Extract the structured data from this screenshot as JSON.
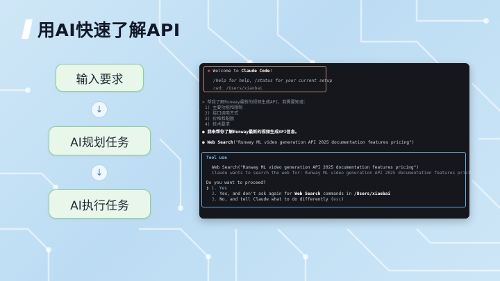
{
  "page": {
    "title": "用AI快速了解API"
  },
  "steps": [
    {
      "label": "输入要求"
    },
    {
      "label": "AI规划任务"
    },
    {
      "label": "AI执行任务"
    }
  ],
  "arrow_glyph": "↓",
  "terminal": {
    "welcome": {
      "bullet": "✻",
      "prefix": "Welcome to ",
      "app_name": "Claude Code",
      "suffix": "!",
      "help": "/help for help, /status for your current setup",
      "cwd": "cwd: /Users/xiaobai"
    },
    "prompt": {
      "marker": ">",
      "text": "帮我了解Runway最新的视频生成API，我需要知道：",
      "items": [
        "1) 主要功能和限制",
        "2) 接口调用方式",
        "3) 价格和配额",
        "4) 技术要求"
      ]
    },
    "reply": {
      "bullet": "●",
      "text": "我来帮你了解Runway最新的视频生成API信息。"
    },
    "tool_call": {
      "bullet": "●",
      "name": "Web Search",
      "args": "(\"Runway ML video generation API 2025 documentation features pricing\")"
    },
    "tool_box": {
      "title": "Tool use",
      "call": "Web Search(\"Runway ML video generation API 2025 documentation features pricing\")",
      "desc": "Claude wants to search the web for: Runway ML video generation API 2025 documentation features pricing",
      "question": "Do you want to proceed?",
      "options": [
        {
          "marker": "❯",
          "num": "1.",
          "text": "Yes"
        },
        {
          "marker": "",
          "num": "2.",
          "text_pre": "Yes, and don't ask again for ",
          "bold1": "Web Search",
          "text_mid": " commands in ",
          "bold2": "/Users/xiaobai"
        },
        {
          "marker": "",
          "num": "3.",
          "text_pre": "No, and tell Claude what to do differently (",
          "key": "esc",
          "text_post": ")"
        }
      ]
    }
  },
  "colors": {
    "accent_green": "#8ccf9a",
    "terminal_bg": "#15171c",
    "claude_orange": "#e0805a",
    "tool_blue": "#7fb4ea"
  }
}
